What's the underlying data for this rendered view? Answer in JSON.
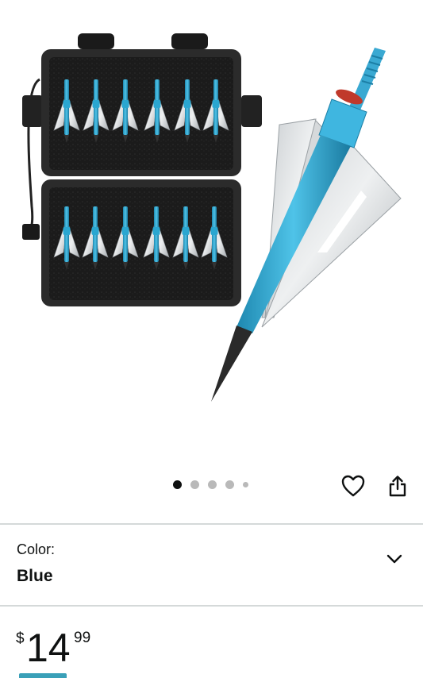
{
  "carousel": {
    "dot_count": 5,
    "active_index": 0
  },
  "actions": {
    "favorite_icon": "heart-icon",
    "share_icon": "share-icon"
  },
  "variation": {
    "label": "Color:",
    "value": "Blue",
    "dropdown_icon": "chevron-down-icon"
  },
  "price": {
    "symbol": "$",
    "whole": "14",
    "fraction": "99"
  },
  "colors": {
    "accent": "#3aa0b8",
    "text": "#0f1111",
    "divider": "#d5d9d9",
    "inactive_dot": "#b9b9b9"
  }
}
